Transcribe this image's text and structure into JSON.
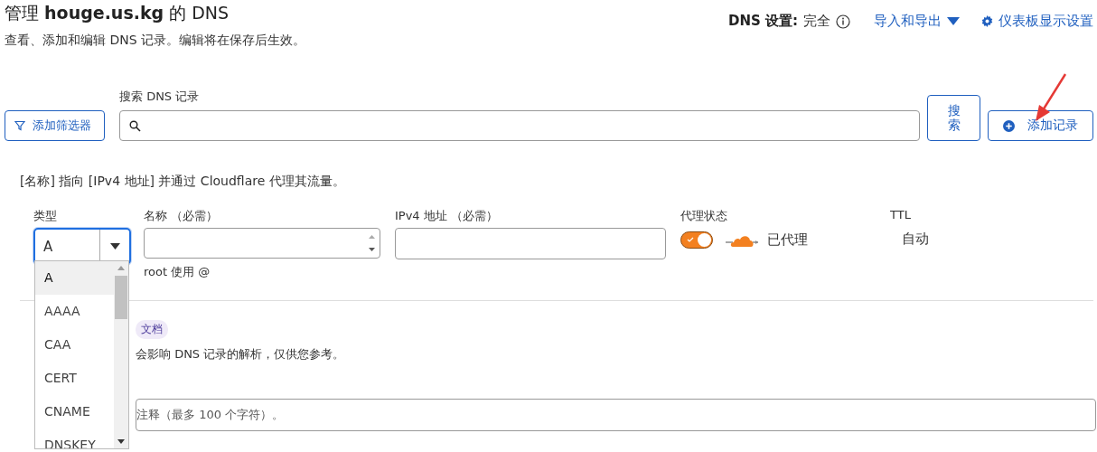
{
  "header": {
    "title": "管理 **houge.us.kg** 的 DNS",
    "subtitle": "查看、添加和编辑 DNS 记录。编辑将在保存后生效。",
    "dns_setting_label": "DNS 设置:",
    "dns_setting_value": "完全",
    "import_export": "导入和导出",
    "dashboard_settings": "仪表板显示设置"
  },
  "toolbar": {
    "filter_button": "添加筛选器",
    "search_label": "搜索 DNS 记录",
    "search_button": "搜索",
    "add_button": "添加记录"
  },
  "form": {
    "hint": "[名称] 指向 [IPv4 地址] 并通过 Cloudflare 代理其流量。",
    "type": {
      "label": "类型",
      "value": "A"
    },
    "name": {
      "label": "名称 （必需）",
      "help": "root 使用 @"
    },
    "ipv4": {
      "label": "IPv4 地址 （必需）"
    },
    "proxy": {
      "label": "代理状态",
      "on": true,
      "status": "已代理"
    },
    "ttl": {
      "label": "TTL",
      "value": "自动"
    },
    "docs_tag": "文档",
    "comment_note": "会影响 DNS 记录的解析，仅供您参考。",
    "comment_placeholder": "注释（最多 100 个字符）。"
  },
  "type_dropdown": [
    {
      "label": "A",
      "selected": true
    },
    {
      "label": "AAAA",
      "selected": false
    },
    {
      "label": "CAA",
      "selected": false
    },
    {
      "label": "CERT",
      "selected": false
    },
    {
      "label": "CNAME",
      "selected": false
    },
    {
      "label": "DNSKEY",
      "selected": false
    }
  ]
}
